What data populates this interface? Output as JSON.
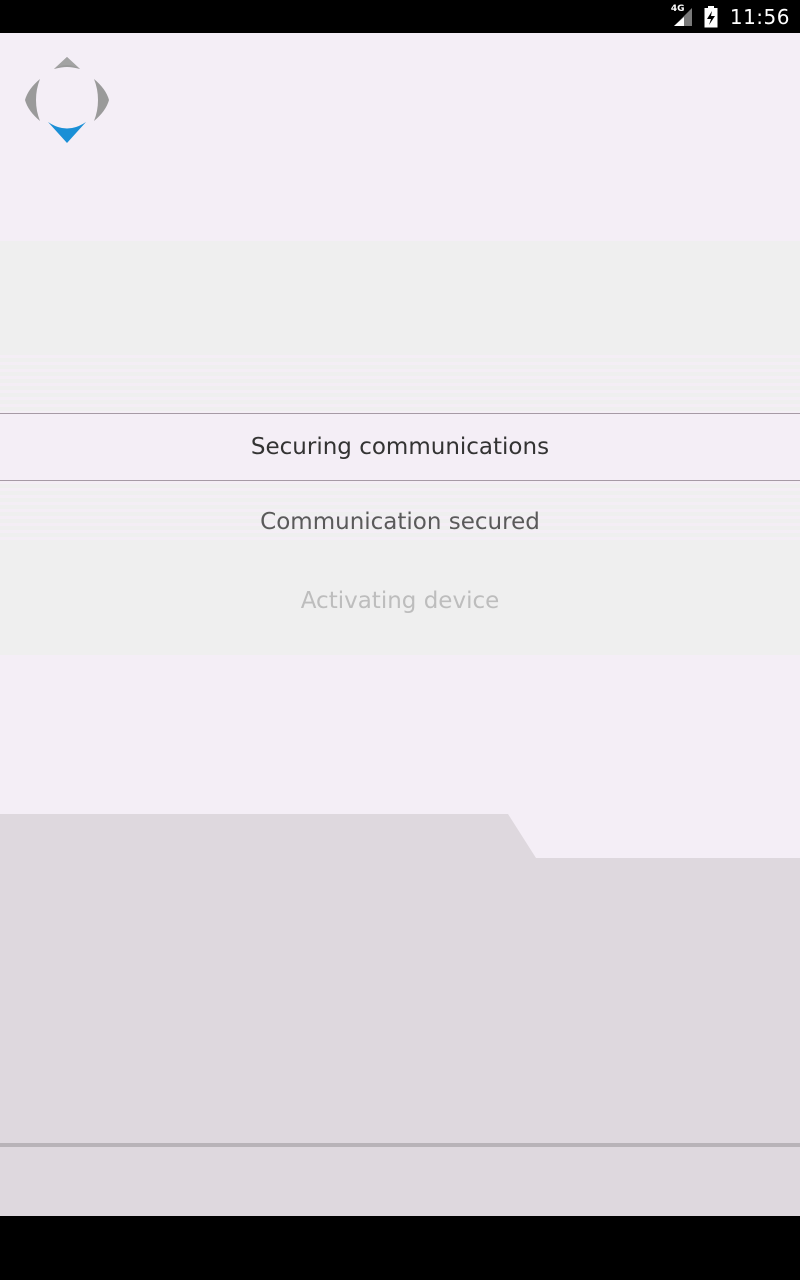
{
  "status_bar": {
    "network": "4G",
    "time": "11:56",
    "icons": [
      "signal-icon",
      "battery-charging-icon"
    ]
  },
  "colors": {
    "background": "#f4eef6",
    "panel": "#efefef",
    "footer": "#ded8de",
    "logo_gray": "#9a9a9a",
    "logo_blue": "#1a8fd6"
  },
  "steps": [
    {
      "label": "Securing communications",
      "state": "active"
    },
    {
      "label": "Communication secured",
      "state": "done"
    },
    {
      "label": "Activating device",
      "state": "pending"
    }
  ]
}
